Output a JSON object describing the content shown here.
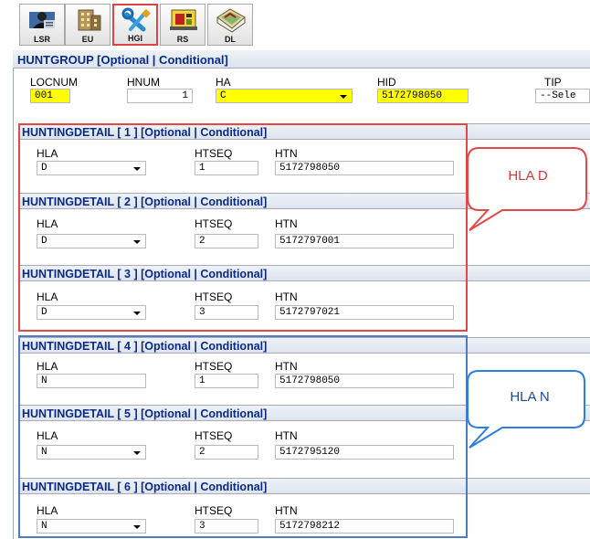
{
  "toolbar": {
    "buttons": [
      {
        "label": "LSR",
        "icon": "lsr-icon"
      },
      {
        "label": "EU",
        "icon": "eu-icon"
      },
      {
        "label": "HGI",
        "icon": "hgi-icon"
      },
      {
        "label": "RS",
        "icon": "rs-icon"
      },
      {
        "label": "DL",
        "icon": "dl-icon"
      }
    ],
    "active": "HGI"
  },
  "huntgroup": {
    "title": "HUNTGROUP [Optional | Conditional]",
    "labels": {
      "locnum": "LOCNUM",
      "hnum": "HNUM",
      "ha": "HA",
      "hid": "HID",
      "tip": "TIP"
    },
    "values": {
      "locnum": "001",
      "hnum": "1",
      "ha": "C",
      "hid": "5172798050",
      "tip": "--Sele"
    }
  },
  "detail_labels": {
    "hla": "HLA",
    "htseq": "HTSEQ",
    "htn": "HTN"
  },
  "details": [
    {
      "title": "HUNTINGDETAIL [ 1 ] [Optional | Conditional]",
      "hla": "D",
      "htseq": "1",
      "htn": "5172798050"
    },
    {
      "title": "HUNTINGDETAIL [ 2 ] [Optional | Conditional]",
      "hla": "D",
      "htseq": "2",
      "htn": "5172797001"
    },
    {
      "title": "HUNTINGDETAIL [ 3 ] [Optional | Conditional]",
      "hla": "D",
      "htseq": "3",
      "htn": "5172797021"
    },
    {
      "title": "HUNTINGDETAIL [ 4 ] [Optional | Conditional]",
      "hla": "N",
      "htseq": "1",
      "htn": "5172798050"
    },
    {
      "title": "HUNTINGDETAIL [ 5 ] [Optional | Conditional]",
      "hla": "N",
      "htseq": "2",
      "htn": "5172795120"
    },
    {
      "title": "HUNTINGDETAIL [ 6 ] [Optional | Conditional]",
      "hla": "N",
      "htseq": "3",
      "htn": "5172798212"
    }
  ],
  "callouts": {
    "red": "HLA D",
    "blue": "HLA N"
  },
  "colors": {
    "required_field": "#ffff00",
    "section_title": "#0a2a8a",
    "red_annotation": "#e34848",
    "blue_annotation": "#4e7cc3"
  }
}
